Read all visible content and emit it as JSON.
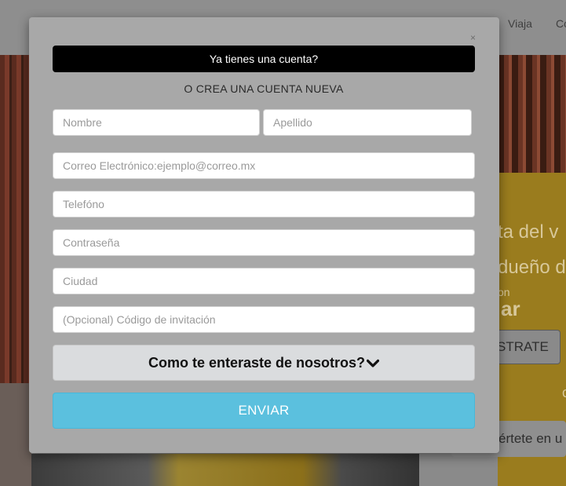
{
  "background": {
    "nav": [
      "Viaja",
      "Co"
    ],
    "hero_line_1": "ta del v",
    "hero_line_2": "dueño d",
    "hero_small": "on",
    "hero_brand": "ar",
    "register_label": "STRATE",
    "bottom_char": "c",
    "bottom_pill": "értete en u"
  },
  "modal": {
    "close_label": "×",
    "login_prompt": "Ya tienes una cuenta?",
    "subtitle": "O CREA UNA CUENTA NUEVA",
    "fields": {
      "first_name": "Nombre",
      "last_name": "Apellido",
      "email": "Correo Electrónico:ejemplo@correo.mx",
      "phone": "Telefóno",
      "password": "Contraseña",
      "city": "Ciudad",
      "invite_code": "(Opcional) Código de invitación"
    },
    "referral_select_label": "Como te enteraste de nosotros?",
    "submit_label": "ENVIAR"
  },
  "colors": {
    "overlay": "#8a8a8a",
    "modal_bg": "#a8a8a8",
    "login_bar": "#000000",
    "submit_bg": "#5bc0de",
    "select_bg": "#dadcde"
  }
}
